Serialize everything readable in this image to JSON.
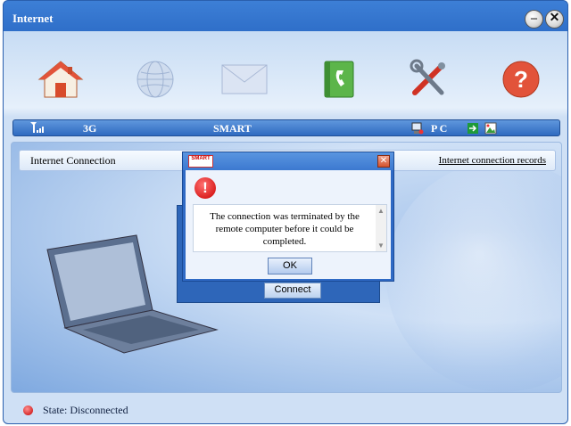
{
  "window": {
    "title": "Internet",
    "minimize_label": "–",
    "close_label": "✕"
  },
  "toolbar": {
    "items": [
      {
        "name": "home",
        "icon": "house-icon"
      },
      {
        "name": "internet",
        "icon": "globe-icon"
      },
      {
        "name": "messages",
        "icon": "envelope-icon"
      },
      {
        "name": "phonebook",
        "icon": "phonebook-icon"
      },
      {
        "name": "settings",
        "icon": "tools-icon"
      },
      {
        "name": "help",
        "icon": "help-icon",
        "label": "?"
      }
    ]
  },
  "status": {
    "network_type": "3G",
    "operator": "SMART",
    "device": "P C"
  },
  "panel": {
    "header_title": "Internet Connection",
    "records_link": "Internet connection records",
    "connect_label": "Connect"
  },
  "dialog": {
    "logo_text": "SMART",
    "close_label": "✕",
    "message": "The connection was terminated by the remote computer before it could be completed.",
    "ok_label": "OK",
    "icon_label": "!"
  },
  "footer": {
    "state_text": "State: Disconnected"
  },
  "colors": {
    "accent": "#2f6fc9",
    "error": "#cc0000",
    "toolbar_bg": "#dde9f8"
  }
}
